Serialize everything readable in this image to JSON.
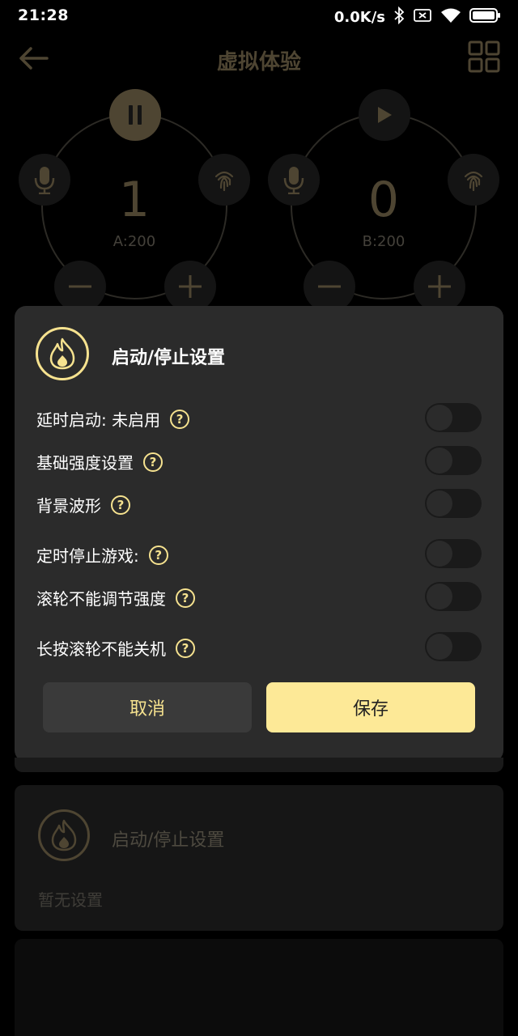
{
  "status_bar": {
    "time": "21:28",
    "net_speed": "0.0K/s",
    "icons": [
      "bluetooth-icon",
      "sim-blocked-icon",
      "wifi-icon",
      "battery-icon"
    ]
  },
  "header": {
    "title": "虚拟体验",
    "back_icon": "arrow-left-icon",
    "menu_icon": "grid-icon"
  },
  "channels": [
    {
      "value": "1",
      "label": "A:200",
      "state": "playing"
    },
    {
      "value": "0",
      "label": "B:200",
      "state": "paused"
    }
  ],
  "dialog": {
    "title": "启动/停止设置",
    "items": [
      {
        "label": "延时启动: 未启用",
        "enabled": false
      },
      {
        "label": "基础强度设置",
        "enabled": false
      },
      {
        "label": "背景波形",
        "enabled": false
      },
      {
        "label": "定时停止游戏:",
        "enabled": false
      },
      {
        "label": "滚轮不能调节强度",
        "enabled": false
      },
      {
        "label": "长按滚轮不能关机",
        "enabled": false
      }
    ],
    "help_glyph": "?",
    "cancel_label": "取消",
    "save_label": "保存"
  },
  "background_panel": {
    "title": "启动/停止设置",
    "empty_text": "暂无设置"
  },
  "colors": {
    "accent": "#f6e28f",
    "save_button": "#fde997",
    "dialog_bg": "#2b2b2b",
    "dim_gold": "#4e4532"
  }
}
